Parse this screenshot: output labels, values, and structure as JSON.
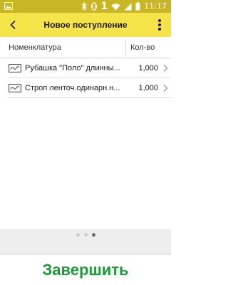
{
  "status_bar": {
    "time": "11:17",
    "sim_digit": "1",
    "icons": [
      "image-icon",
      "bluetooth-icon",
      "vibrate-icon",
      "wifi-icon",
      "signal-icon",
      "battery-icon"
    ]
  },
  "appbar": {
    "title": "Новое поступление",
    "back_icon": "back-arrow-icon",
    "menu_icon": "more-vert-icon",
    "color": "#f4e44a"
  },
  "table": {
    "columns": [
      "Номенклатура",
      "Кол-во"
    ],
    "rows": [
      {
        "name": "Рубашка \"Поло\" длинны...",
        "qty": "1,000"
      },
      {
        "name": "Строп ленточ.одинарн.н...",
        "qty": "1,000"
      }
    ]
  },
  "pager": {
    "dots": 3,
    "active": 3
  },
  "footer": {
    "finish_label": "Завершить",
    "color": "#1f9a3a"
  }
}
